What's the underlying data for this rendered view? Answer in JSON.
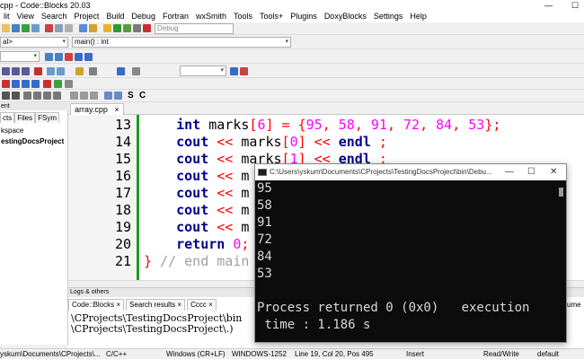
{
  "window": {
    "title": "cpp - Code::Blocks 20.03",
    "min": "—",
    "max": "☐"
  },
  "menu": [
    "lit",
    "View",
    "Search",
    "Project",
    "Build",
    "Debug",
    "Fortran",
    "wxSmith",
    "Tools",
    "Tools+",
    "Plugins",
    "DoxyBlocks",
    "Settings",
    "Help"
  ],
  "toolbar": {
    "build_target": "Debug",
    "scope": "al>",
    "function": "main() : int"
  },
  "left_panel": {
    "header": "ent",
    "tabs": [
      "cts",
      "Files",
      "FSym"
    ],
    "items": [
      "kspace",
      "estingDocsProject"
    ]
  },
  "editor": {
    "tab_label": "array.cpp",
    "tab_close": "×",
    "lines": [
      {
        "n": "13",
        "segments": [
          {
            "t": "    "
          },
          {
            "t": "int",
            "c": "kw"
          },
          {
            "t": " marks"
          },
          {
            "t": "[",
            "c": "op"
          },
          {
            "t": "6",
            "c": "num"
          },
          {
            "t": "]",
            "c": "op"
          },
          {
            "t": " "
          },
          {
            "t": "=",
            "c": "op"
          },
          {
            "t": " "
          },
          {
            "t": "{",
            "c": "op"
          },
          {
            "t": "95",
            "c": "num"
          },
          {
            "t": ",",
            "c": "op"
          },
          {
            "t": " "
          },
          {
            "t": "58",
            "c": "num"
          },
          {
            "t": ",",
            "c": "op"
          },
          {
            "t": " "
          },
          {
            "t": "91",
            "c": "num"
          },
          {
            "t": ",",
            "c": "op"
          },
          {
            "t": " "
          },
          {
            "t": "72",
            "c": "num"
          },
          {
            "t": ",",
            "c": "op"
          },
          {
            "t": " "
          },
          {
            "t": "84",
            "c": "num"
          },
          {
            "t": ",",
            "c": "op"
          },
          {
            "t": " "
          },
          {
            "t": "53",
            "c": "num"
          },
          {
            "t": "};",
            "c": "op"
          }
        ]
      },
      {
        "n": "14",
        "segments": [
          {
            "t": "    "
          },
          {
            "t": "cout",
            "c": "kw"
          },
          {
            "t": " "
          },
          {
            "t": "<<",
            "c": "op"
          },
          {
            "t": " marks"
          },
          {
            "t": "[",
            "c": "op"
          },
          {
            "t": "0",
            "c": "num"
          },
          {
            "t": "]",
            "c": "op"
          },
          {
            "t": " "
          },
          {
            "t": "<<",
            "c": "op"
          },
          {
            "t": " "
          },
          {
            "t": "endl",
            "c": "kw"
          },
          {
            "t": " "
          },
          {
            "t": ";",
            "c": "op"
          }
        ]
      },
      {
        "n": "15",
        "segments": [
          {
            "t": "    "
          },
          {
            "t": "cout",
            "c": "kw"
          },
          {
            "t": " "
          },
          {
            "t": "<<",
            "c": "op"
          },
          {
            "t": " marks"
          },
          {
            "t": "[",
            "c": "op"
          },
          {
            "t": "1",
            "c": "num"
          },
          {
            "t": "]",
            "c": "op"
          },
          {
            "t": " "
          },
          {
            "t": "<<",
            "c": "op"
          },
          {
            "t": " "
          },
          {
            "t": "endl",
            "c": "kw"
          },
          {
            "t": " "
          },
          {
            "t": ";",
            "c": "op"
          }
        ]
      },
      {
        "n": "16",
        "segments": [
          {
            "t": "    "
          },
          {
            "t": "cout",
            "c": "kw"
          },
          {
            "t": " "
          },
          {
            "t": "<<",
            "c": "op"
          },
          {
            "t": " m"
          }
        ]
      },
      {
        "n": "17",
        "segments": [
          {
            "t": "    "
          },
          {
            "t": "cout",
            "c": "kw"
          },
          {
            "t": " "
          },
          {
            "t": "<<",
            "c": "op"
          },
          {
            "t": " m"
          }
        ]
      },
      {
        "n": "18",
        "segments": [
          {
            "t": "    "
          },
          {
            "t": "cout",
            "c": "kw"
          },
          {
            "t": " "
          },
          {
            "t": "<<",
            "c": "op"
          },
          {
            "t": " m"
          }
        ]
      },
      {
        "n": "19",
        "segments": [
          {
            "t": "    "
          },
          {
            "t": "cout",
            "c": "kw"
          },
          {
            "t": " "
          },
          {
            "t": "<<",
            "c": "op"
          },
          {
            "t": " m"
          }
        ]
      },
      {
        "n": "20",
        "segments": [
          {
            "t": "    "
          },
          {
            "t": "return",
            "c": "kw"
          },
          {
            "t": " "
          },
          {
            "t": "0",
            "c": "num"
          },
          {
            "t": ";",
            "c": "op"
          }
        ]
      },
      {
        "n": "21",
        "segments": [
          {
            "t": "}",
            "c": "op"
          },
          {
            "t": " // end main",
            "c": "cm"
          }
        ]
      }
    ]
  },
  "logs": {
    "header": "Logs & others",
    "tabs": [
      "Code::Blocks ×",
      "Search results ×",
      "Cccc ×"
    ],
    "right_tab": "ume",
    "lines": [
      "\\CProjects\\TestingDocsProject\\bin",
      "\\CProjects\\TestingDocsProject\\.)"
    ]
  },
  "console": {
    "title": "C:\\Users\\yskum\\Documents\\CProjects\\TestingDocsProject\\bin\\Debu...",
    "output": [
      "95",
      "58",
      "91",
      "72",
      "84",
      "53",
      "",
      "Process returned 0 (0x0)   execution",
      " time : 1.186 s"
    ]
  },
  "status": {
    "path": "yskum\\Documents\\CProjects\\...",
    "lang": "C/C++",
    "eol": "Windows (CR+LF)",
    "encoding": "WINDOWS-1252",
    "position": "Line 19, Col 20, Pos 495",
    "mode": "Insert",
    "access": "Read/Write",
    "profile": "default"
  },
  "colors": {
    "keyword": "#00008b",
    "operator": "#ff0000",
    "number": "#ff00ff",
    "comment": "#a0a0a0",
    "changebar": "#1a9b1a"
  }
}
